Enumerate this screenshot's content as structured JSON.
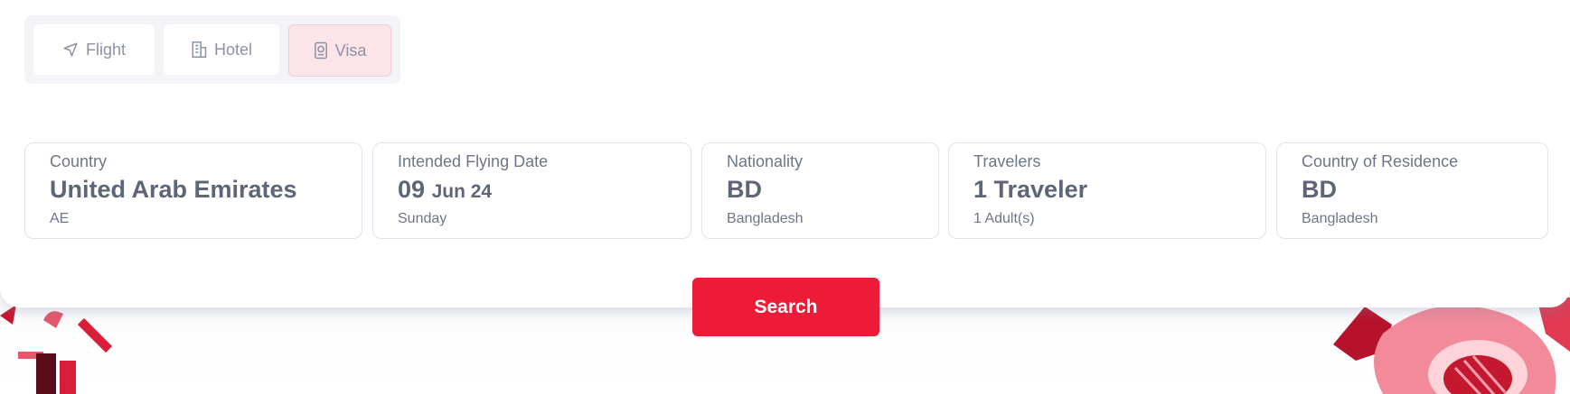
{
  "tabs": [
    {
      "label": "Flight",
      "icon": "send-icon"
    },
    {
      "label": "Hotel",
      "icon": "building-icon"
    },
    {
      "label": "Visa",
      "icon": "passport-icon",
      "active": true
    }
  ],
  "fields": {
    "country": {
      "label": "Country",
      "value": "United Arab Emirates",
      "sub": "AE"
    },
    "date": {
      "label": "Intended Flying Date",
      "day": "09",
      "month_year": "Jun 24",
      "sub": "Sunday"
    },
    "nationality": {
      "label": "Nationality",
      "value": "BD",
      "sub": "Bangladesh"
    },
    "travelers": {
      "label": "Travelers",
      "value": "1 Traveler",
      "sub": "1 Adult(s)"
    },
    "residence": {
      "label": "Country of Residence",
      "value": "BD",
      "sub": "Bangladesh"
    }
  },
  "search_label": "Search",
  "colors": {
    "accent": "#ed1b37",
    "active_tab_bg": "#fde4e8",
    "text_muted": "#6d7588"
  }
}
